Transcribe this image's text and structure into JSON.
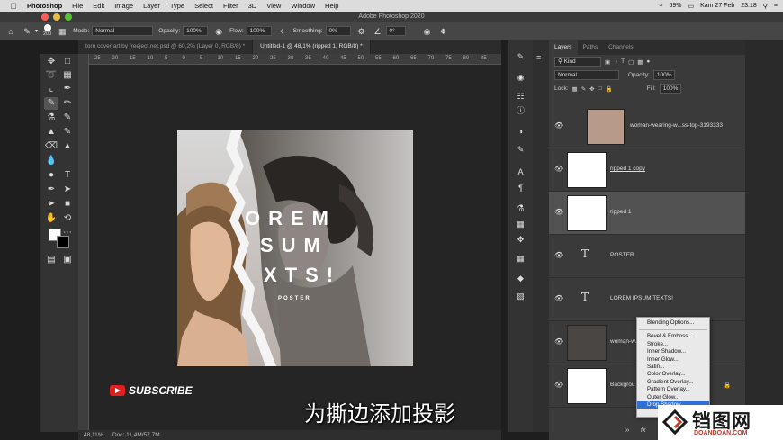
{
  "menubar": {
    "apple": "",
    "items": [
      "Photoshop",
      "File",
      "Edit",
      "Image",
      "Layer",
      "Type",
      "Select",
      "Filter",
      "3D",
      "View",
      "Window",
      "Help"
    ],
    "battery": "69%",
    "date": "Kam 27 Feb",
    "time": "23.18"
  },
  "window": {
    "title": "Adobe Photoshop 2020"
  },
  "options": {
    "brush_size": "200",
    "mode_label": "Mode:",
    "mode_value": "Normal",
    "opacity_label": "Opacity:",
    "opacity_value": "100%",
    "flow_label": "Flow:",
    "flow_value": "100%",
    "smoothing_label": "Smoothing:",
    "smoothing_value": "0%",
    "angle": "0°"
  },
  "tabs": [
    {
      "label": "torn cover art by freeject.net.psd @ 60,2% (Layer 0, RGB/8) *"
    },
    {
      "label": "Untitled-1 @ 48,1% (ripped 1, RGB/8) *"
    }
  ],
  "ruler": [
    "25",
    "20",
    "15",
    "10",
    "5",
    "0",
    "5",
    "10",
    "15",
    "20",
    "25",
    "30",
    "35",
    "40",
    "45",
    "50",
    "55",
    "60",
    "65",
    "70",
    "75",
    "80",
    "85"
  ],
  "poster": {
    "line1": "OREM",
    "line2": "SUM",
    "line3": "XTS!",
    "small": "POSTER"
  },
  "status": {
    "zoom": "48,11%",
    "doc": "Doc: 11,4M/57,7M"
  },
  "layers_panel": {
    "tabs": [
      "Layers",
      "Paths",
      "Channels"
    ],
    "kind": "Kind",
    "blend": "Normal",
    "opacity_label": "Opacity:",
    "opacity_value": "100%",
    "lock_label": "Lock:",
    "fill_label": "Fill:",
    "fill_value": "100%",
    "layers": [
      {
        "name": "woman-wearing-w...ss-top-3193333"
      },
      {
        "name": "ripped 1 copy"
      },
      {
        "name": "ripped 1"
      },
      {
        "name": "POSTER"
      },
      {
        "name": "LOREM IPSUM TEXTS!"
      },
      {
        "name": "woman-w...42"
      },
      {
        "name": "Backgrou"
      }
    ],
    "fx": "fx"
  },
  "context_menu": {
    "items": [
      "Blending Options...",
      "Bevel & Emboss...",
      "Stroke...",
      "Inner Shadow...",
      "Inner Glow...",
      "Satin...",
      "Color Overlay...",
      "Gradient Overlay...",
      "Pattern Overlay...",
      "Outer Glow...",
      "Drop Shadow..."
    ]
  },
  "overlay": {
    "subscribe": "SUBSCRIBE",
    "subtitle": "为撕边添加投影",
    "watermark": "铛图网",
    "watermark_domain": "DOANDOAN.COM"
  }
}
